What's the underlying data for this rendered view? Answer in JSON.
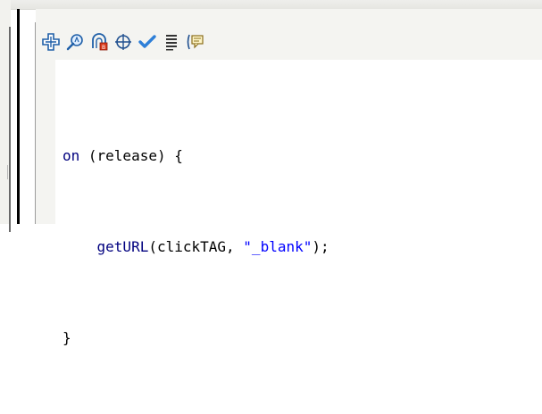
{
  "toolbar": {
    "buttons": [
      {
        "name": "add-statement-button",
        "icon": "plus-icon"
      },
      {
        "name": "find-button",
        "icon": "magnifier-icon"
      },
      {
        "name": "insert-target-path-button",
        "icon": "target-path-icon"
      },
      {
        "name": "crosshair-target-button",
        "icon": "crosshair-icon"
      },
      {
        "name": "check-syntax-button",
        "icon": "checkmark-icon"
      },
      {
        "name": "auto-format-button",
        "icon": "auto-format-icon"
      },
      {
        "name": "show-code-hint-button",
        "icon": "code-hint-icon"
      }
    ]
  },
  "code": {
    "line1": {
      "keyword": "on",
      "rest": " (release) {"
    },
    "line2": {
      "indent": "    ",
      "func": "getURL",
      "args_open": "(clickTAG, ",
      "string": "\"_blank\"",
      "args_close": ");"
    },
    "line3": {
      "text": "}"
    }
  },
  "colors": {
    "keyword": "#00007f",
    "string": "#0000ff",
    "plain": "#000000",
    "toolbar_bg": "#f4f4f1"
  }
}
